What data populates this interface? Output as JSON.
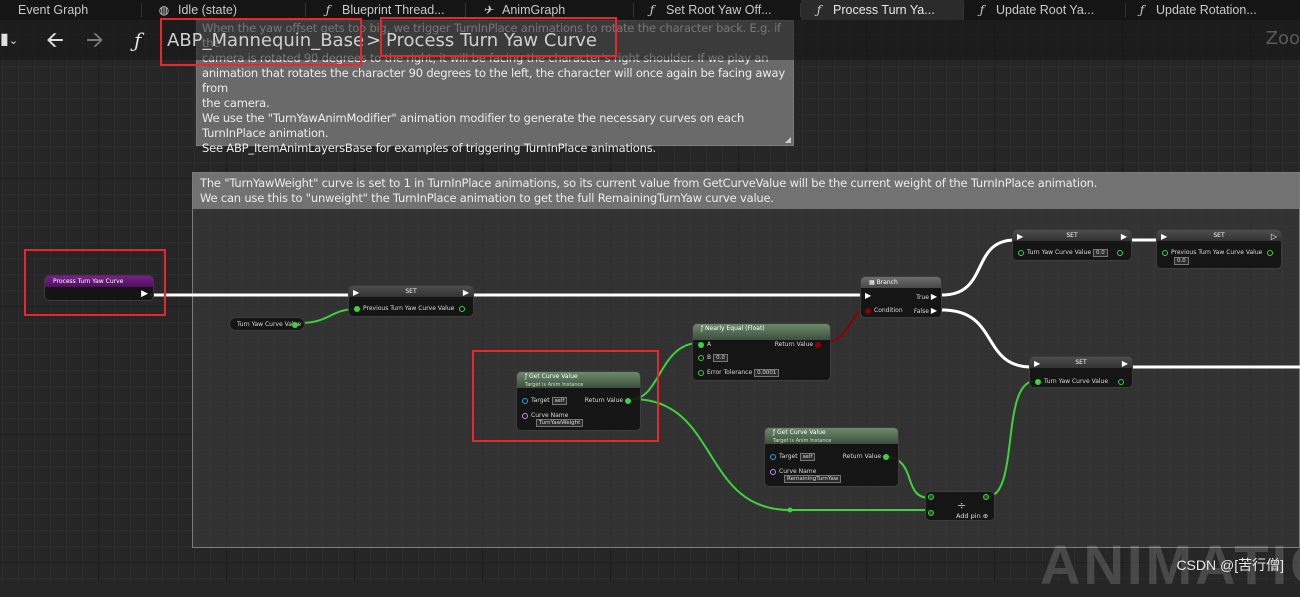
{
  "tabs": [
    {
      "label": "Event Graph",
      "icon": "graph-icon"
    },
    {
      "label": "Idle (state)",
      "icon": "state-icon"
    },
    {
      "label": "Blueprint Thread...",
      "icon": "function-icon"
    },
    {
      "label": "AnimGraph",
      "icon": "anim-graph-icon"
    },
    {
      "label": "Set Root Yaw Off...",
      "icon": "function-icon"
    },
    {
      "label": "Process Turn Ya...",
      "icon": "function-icon",
      "active": true
    },
    {
      "label": "Update Root Ya...",
      "icon": "function-icon"
    },
    {
      "label": "Update Rotation...",
      "icon": "function-icon"
    }
  ],
  "breadcrumb": {
    "root": "ABP_Mannequin_Base",
    "separator": ">",
    "current": "Process Turn Yaw Curve"
  },
  "zoom_label": "Zoo",
  "comment_top": {
    "text": "When the yaw offset gets too big, we trigger TurnInPlace animations to rotate the character back. E.g. if the\ncamera is rotated 90 degrees to the right, it will be facing the character's right shoulder. If we play an\nanimation that rotates the character 90 degrees to the left, the character will once again be facing away from\nthe camera.\nWe use the \"TurnYawAnimModifier\" animation modifier to generate the necessary curves on each\nTurnInPlace animation.\nSee ABP_ItemAnimLayersBase for examples of triggering TurnInPlace animations."
  },
  "comment_main": {
    "text": "The \"TurnYawWeight\" curve is set to 1 in TurnInPlace animations, so its current value from GetCurveValue will be the current weight of the TurnInPlace animation.\nWe can use this to \"unweight\" the TurnInPlace animation to get the full RemainingTurnYaw curve value."
  },
  "nodes": {
    "entry": {
      "title": "Process Turn Yaw Curve"
    },
    "set1": {
      "title": "SET",
      "pin": "Previous Turn Yaw Curve Value"
    },
    "var_turn": {
      "title": "Turn Yaw Curve Value"
    },
    "branch": {
      "title": "Branch",
      "cond": "Condition",
      "true": "True",
      "false": "False"
    },
    "nearly": {
      "title": "Nearly Equal (Float)",
      "a": "A",
      "b": "B",
      "b_val": "0.0",
      "tol": "Error Tolerance",
      "tol_val": "0.0001",
      "ret": "Return Value"
    },
    "gcv1": {
      "title": "Get Curve Value",
      "sub": "Target is Anim Instance",
      "target": "Target",
      "target_val": "self",
      "curve": "Curve Name",
      "curve_val": "TurnYawWeight",
      "ret": "Return Value"
    },
    "gcv2": {
      "title": "Get Curve Value",
      "sub": "Target is Anim Instance",
      "target": "Target",
      "target_val": "self",
      "curve": "Curve Name",
      "curve_val": "RemainingTurnYaw",
      "ret": "Return Value"
    },
    "set_top": {
      "title": "SET",
      "pin": "Turn Yaw Curve Value",
      "val": "0.0"
    },
    "set_top2": {
      "title": "SET",
      "pin": "Previous Turn Yaw Curve Value",
      "val": "0.0"
    },
    "set_bottom": {
      "title": "SET",
      "pin": "Turn Yaw Curve Value"
    },
    "divide": {
      "symbol": "÷",
      "add_pin": "Add pin"
    }
  },
  "watermark": "ANIMATIO",
  "csdn_label": "CSDN @[苦行僧]",
  "colors": {
    "highlight": "#e8262b",
    "exec": "#ffffff",
    "float_pin": "#3ed13e",
    "bool_pin": "#8c0000",
    "object_pin": "#1aa7e6",
    "name_pin": "#c58ff5"
  }
}
